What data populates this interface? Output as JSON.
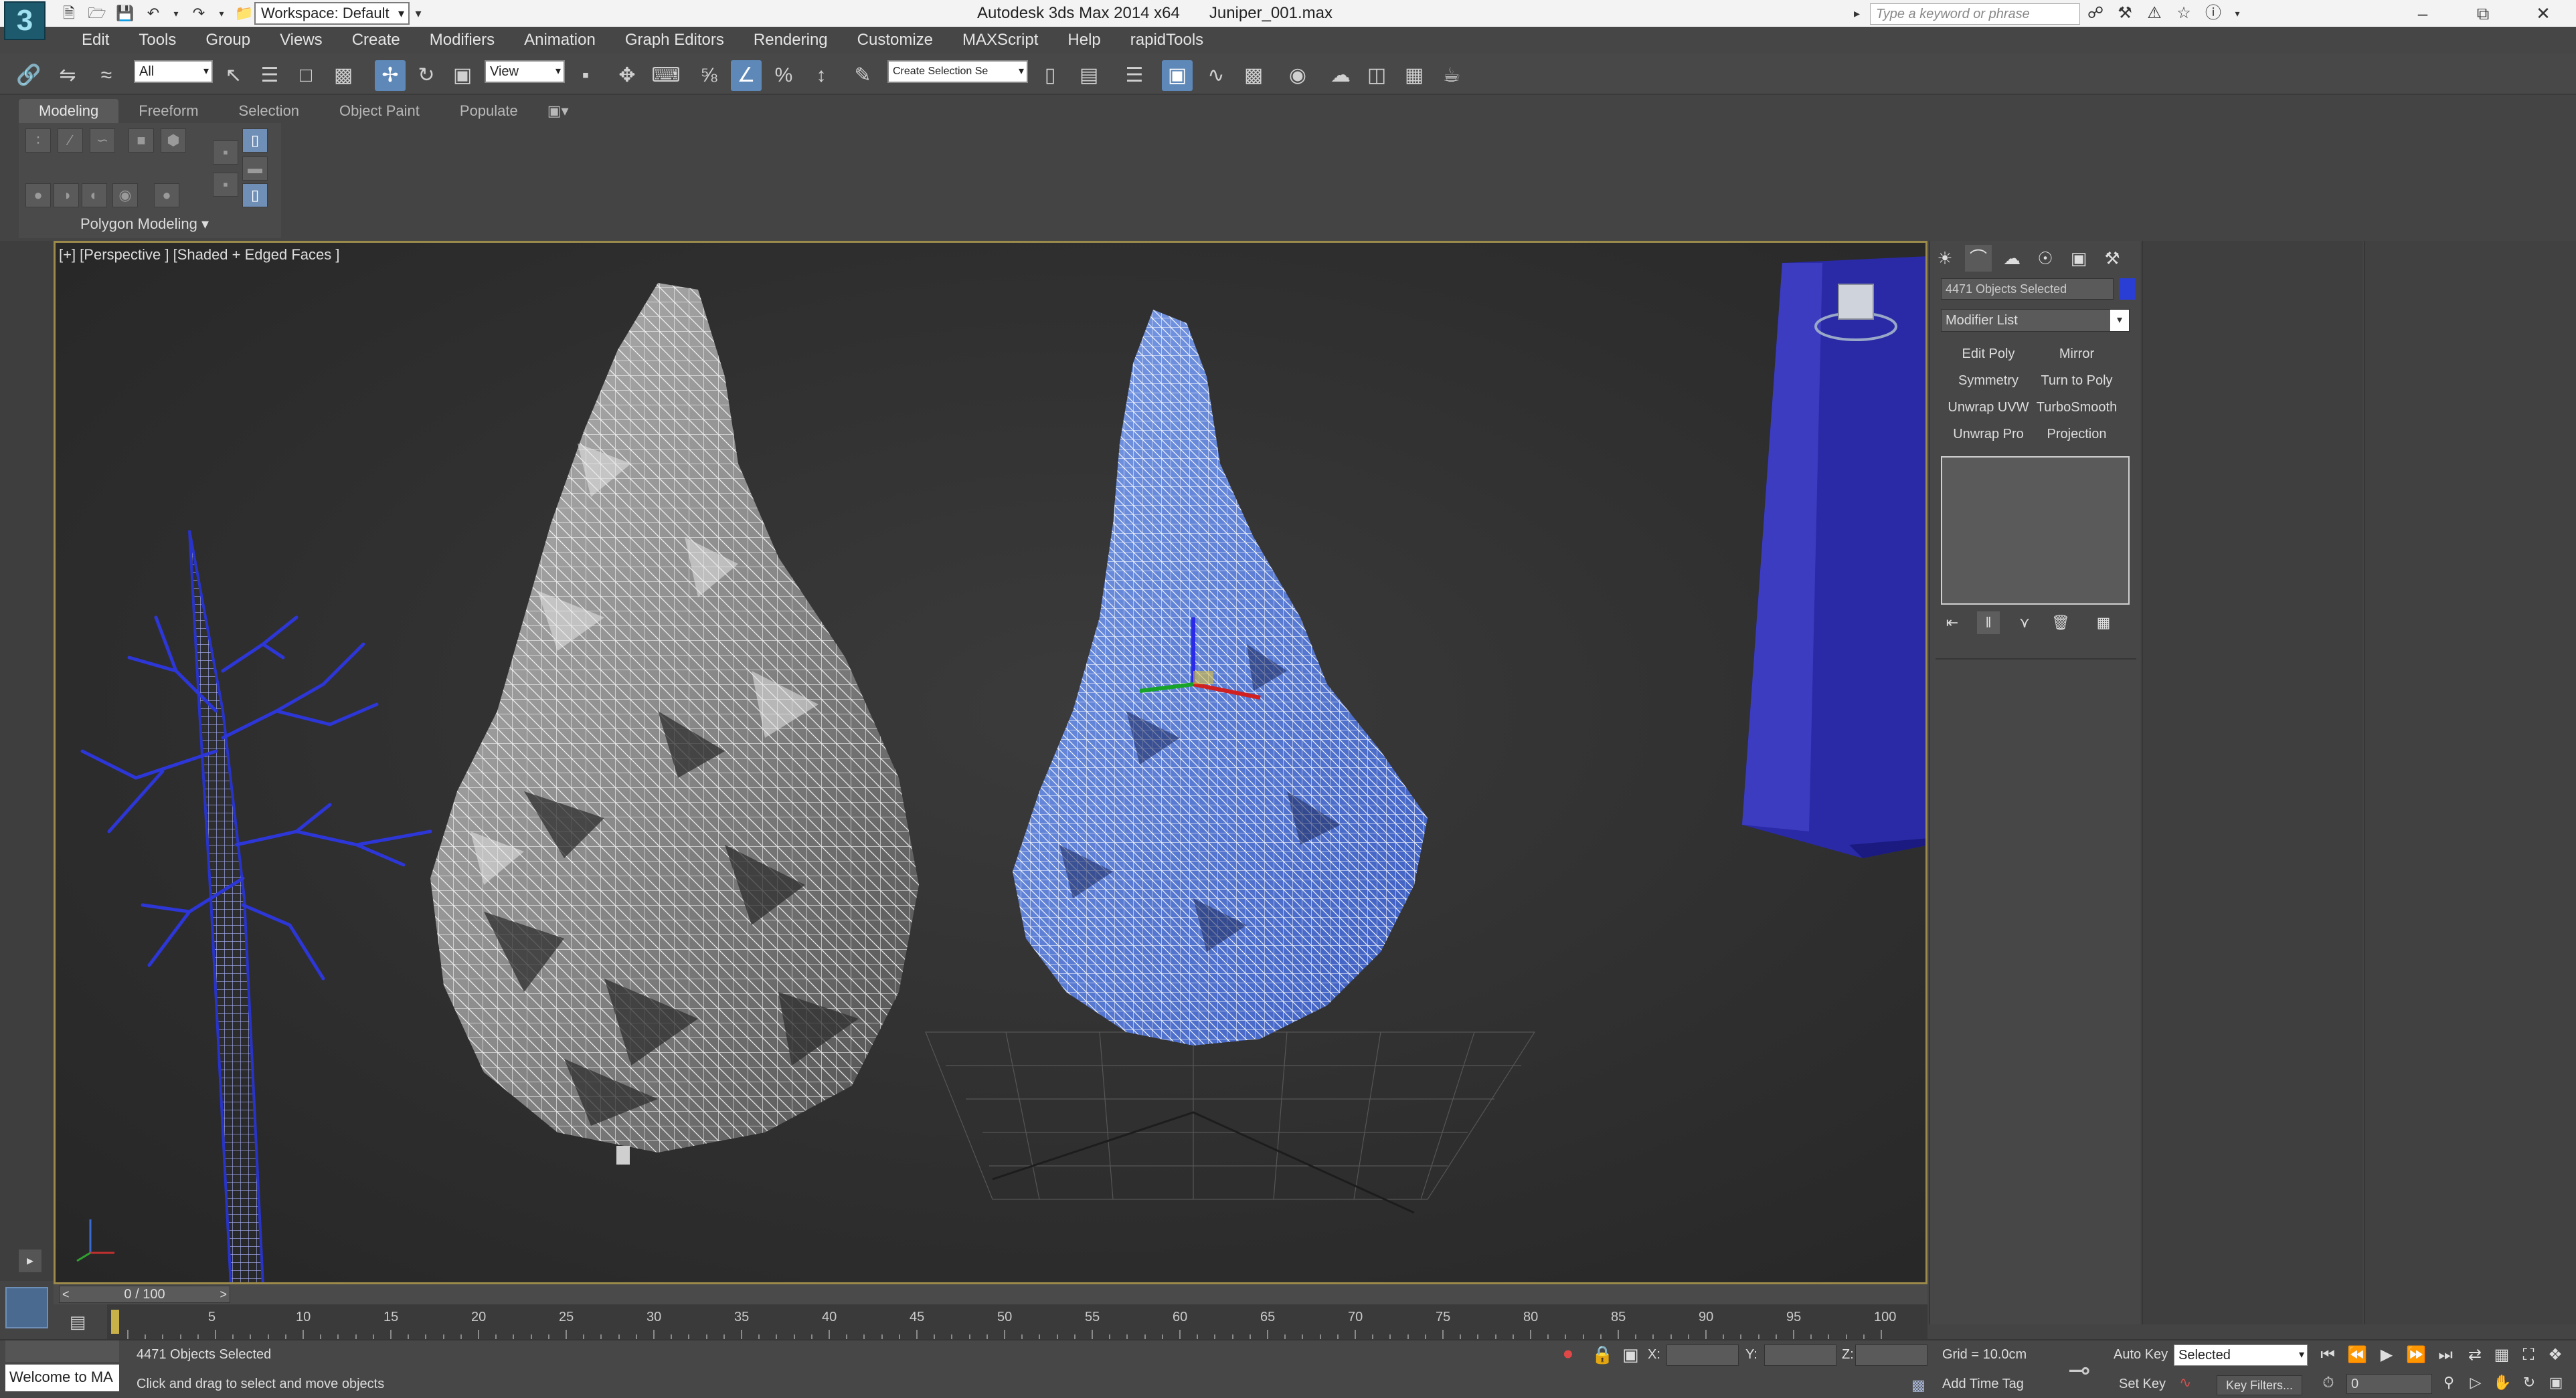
{
  "titlebar": {
    "workspace": "Workspace: Default",
    "app_title": "Autodesk 3ds Max  2014 x64",
    "file_name": "Juniper_001.max",
    "search_placeholder": "Type a keyword or phrase"
  },
  "menu": [
    "Edit",
    "Tools",
    "Group",
    "Views",
    "Create",
    "Modifiers",
    "Animation",
    "Graph Editors",
    "Rendering",
    "Customize",
    "MAXScript",
    "Help",
    "rapidTools"
  ],
  "toolbar": {
    "selection_filter": "All",
    "reference_coord": "View",
    "named_selection": "Create Selection Se"
  },
  "ribbon": {
    "tabs": [
      "Modeling",
      "Freeform",
      "Selection",
      "Object Paint",
      "Populate"
    ],
    "active_tab": "Modeling",
    "panel_label": "Polygon Modeling ▾"
  },
  "viewport": {
    "label": "[+] [Perspective ] [Shaded + Edged Faces ]"
  },
  "command_panel": {
    "selection_name": "4471 Objects Selected",
    "object_color": "#2a3ed6",
    "modifier_list": "Modifier List",
    "modifier_buttons": [
      "Edit Poly",
      "Mirror",
      "Symmetry",
      "Turn to Poly",
      "Unwrap UVW",
      "TurboSmooth",
      "Unwrap Pro",
      "Projection"
    ]
  },
  "timeline": {
    "slider": "0 / 100",
    "ticks": [
      "5",
      "10",
      "15",
      "20",
      "25",
      "30",
      "35",
      "40",
      "45",
      "50",
      "55",
      "60",
      "65",
      "70",
      "75",
      "80",
      "85",
      "90",
      "95",
      "100"
    ]
  },
  "status": {
    "listener": "Welcome to MA",
    "selection_status": "4471 Objects Selected",
    "prompt": "Click and drag to select and move objects",
    "x_label": "X:",
    "y_label": "Y:",
    "z_label": "Z:",
    "grid": "Grid = 10.0cm",
    "add_time_tag": "Add Time Tag",
    "auto_key": "Auto Key",
    "set_key": "Set Key",
    "key_mode": "Selected",
    "key_filters": "Key Filters...",
    "current_frame": "0"
  }
}
